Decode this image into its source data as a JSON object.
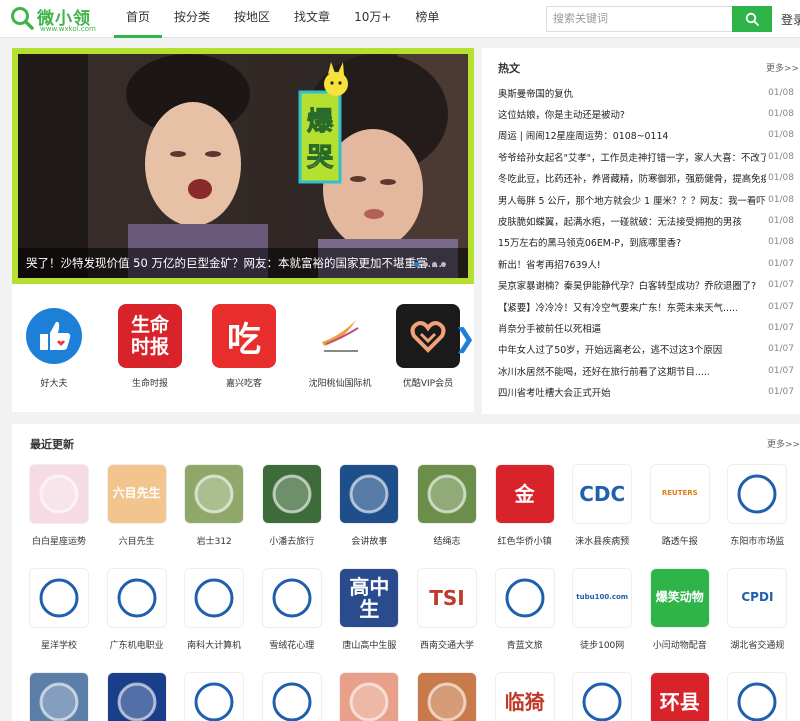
{
  "header": {
    "logo_text": "微小领",
    "logo_url": "www.wxkol.com",
    "nav": [
      "首页",
      "按分类",
      "按地区",
      "找文章",
      "10万+",
      "榜单"
    ],
    "search_placeholder": "搜索关键词",
    "login": "登录",
    "accent": "#2fb44a"
  },
  "banner": {
    "caption": "哭了！沙特发现价值 50 万亿的巨型金矿？网友：本就富裕的国家更加不堪重富.....",
    "overlay_text": "爆哭",
    "frame_color": "#b5e02f"
  },
  "accounts": [
    {
      "name": "好大夫",
      "icon": "thumbs-up-icon"
    },
    {
      "name": "生命时报",
      "icon": "shengming-logo",
      "logo_text": "生命时报"
    },
    {
      "name": "嘉兴吃客",
      "icon": "chi-logo",
      "logo_text": "吃"
    },
    {
      "name": "沈阳桃仙国际机",
      "icon": "airport-logo"
    },
    {
      "name": "优酷VIP会员",
      "icon": "heart-logo"
    }
  ],
  "hot": {
    "title": "热文",
    "more": "更多>>",
    "items": [
      {
        "text": "奥斯曼帝国的复仇",
        "date": "01/08"
      },
      {
        "text": "这位姑娘，你是主动还是被动?",
        "date": "01/08"
      },
      {
        "text": "周运 | 闹闹12星座周运势：0108~0114",
        "date": "01/08"
      },
      {
        "text": "爷爷给孙女起名\"艾孝\"，工作员走神打错一字，家人大喜：不改了",
        "date": "01/08"
      },
      {
        "text": "冬吃此豆，比药还补，养肾藏精，防寒御邪，强筋健骨，提高免疫力",
        "date": "01/08"
      },
      {
        "text": "男人每胖 5 公斤，那个地方就会少 1 厘米？？？网友：我一看吓了一跳",
        "date": "01/08"
      },
      {
        "text": "皮肤脆如蝶翼，起满水疱，一碰就破：无法接受拥抱的男孩",
        "date": "01/08"
      },
      {
        "text": "15万左右的黑马领克06EM-P，到底哪里香?",
        "date": "01/08"
      },
      {
        "text": "新出！省考再招7639人!",
        "date": "01/07"
      },
      {
        "text": "吴京家暴谢楠？秦昊伊能静代孕？白客转型成功？乔欣退圈了?",
        "date": "01/07"
      },
      {
        "text": "【紧要】冷冷冷！又有冷空气要来广东！东莞未来天气.....",
        "date": "01/07"
      },
      {
        "text": "肖奈分手被前任以死相逼",
        "date": "01/07"
      },
      {
        "text": "中年女人过了50岁，开始远离老公，逃不过这3个原因",
        "date": "01/07"
      },
      {
        "text": "冰川水居然不能喝，还好在旅行前看了这期节目.....",
        "date": "01/07"
      },
      {
        "text": "四川省考吐槽大会正式开始",
        "date": "01/07"
      }
    ]
  },
  "recent": {
    "title": "最近更新",
    "more": "更多>>",
    "row1": [
      {
        "name": "白白星座运势",
        "icon": "anime-girl-avatar",
        "bg": "#f6dbe4"
      },
      {
        "name": "六目先生",
        "icon": "liumu-logo",
        "bg": "#f2c48e",
        "logo_text": "六目先生"
      },
      {
        "name": "岩士312",
        "icon": "man-photo",
        "bg": "#8fa86a"
      },
      {
        "name": "小潘去旅行",
        "icon": "panda-photo",
        "bg": "#3d6b3a"
      },
      {
        "name": "会讲故事",
        "icon": "blue-hair-avatar",
        "bg": "#1f4f8a"
      },
      {
        "name": "结绳志",
        "icon": "painting-photo",
        "bg": "#6b8f4a"
      },
      {
        "name": "红色华侨小镇",
        "icon": "red-seal-logo",
        "bg": "#d8232a",
        "logo_text": "金"
      },
      {
        "name": "涞水县疾病预",
        "icon": "cdc-logo",
        "bg": "#ffffff",
        "logo_text": "CDC"
      },
      {
        "name": "路透午报",
        "icon": "reuters-logo",
        "bg": "#ffffff",
        "logo_text": "REUTERS"
      },
      {
        "name": "东阳市市场监",
        "icon": "badge-logo",
        "bg": "#ffffff"
      }
    ],
    "row2": [
      {
        "name": "星洋学校",
        "icon": "school-emblem",
        "bg": "#ffffff"
      },
      {
        "name": "广东机电职业",
        "icon": "college-emblem",
        "bg": "#ffffff"
      },
      {
        "name": "南科大计算机",
        "icon": "univ-emblem",
        "bg": "#ffffff"
      },
      {
        "name": "雪绒花心理",
        "icon": "flower-logo",
        "bg": "#ffffff"
      },
      {
        "name": "唐山高中生服",
        "icon": "text-card-logo",
        "bg": "#2a4c8f",
        "logo_text": "高中生"
      },
      {
        "name": "西南交通大学",
        "icon": "tsi-logo",
        "bg": "#ffffff",
        "logo_text": "TSI"
      },
      {
        "name": "青蓝文旅",
        "icon": "circle-logo",
        "bg": "#ffffff"
      },
      {
        "name": "徒步100网",
        "icon": "tubu-logo",
        "bg": "#ffffff",
        "logo_text": "tubu100.com"
      },
      {
        "name": "小闫动物配音",
        "icon": "animal-logo",
        "bg": "#2fb44a",
        "logo_text": "爆笑动物"
      },
      {
        "name": "湖北省交通规",
        "icon": "cpdi-logo",
        "bg": "#ffffff",
        "logo_text": "CPDI"
      }
    ],
    "row3": [
      {
        "name": "",
        "icon": "building-photo",
        "bg": "#5b7fa8"
      },
      {
        "name": "",
        "icon": "police-badge",
        "bg": "#1a3f8a"
      },
      {
        "name": "",
        "icon": "ff-logo",
        "bg": "#ffffff"
      },
      {
        "name": "",
        "icon": "emblem-logo",
        "bg": "#ffffff"
      },
      {
        "name": "",
        "icon": "heart-photo",
        "bg": "#e8a08a"
      },
      {
        "name": "",
        "icon": "interior-photo",
        "bg": "#c87a4a"
      },
      {
        "name": "",
        "icon": "red-card-logo",
        "bg": "#ffffff",
        "logo_text": "临猗"
      },
      {
        "name": "",
        "icon": "round-logo",
        "bg": "#ffffff"
      },
      {
        "name": "",
        "icon": "red-text-logo",
        "bg": "#d8232a",
        "logo_text": "环县"
      },
      {
        "name": "",
        "icon": "number-logo",
        "bg": "#ffffff"
      }
    ]
  }
}
